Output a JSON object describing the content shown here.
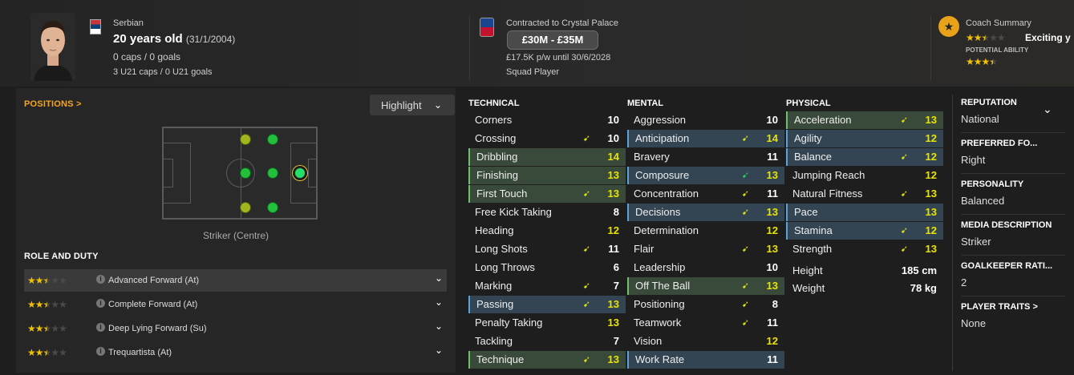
{
  "header": {
    "nationality": "Serbian",
    "age": "20 years old",
    "dob": "(31/1/2004)",
    "caps": "0 caps / 0 goals",
    "u21": "3 U21 caps / 0 U21 goals",
    "contract_title": "Contracted to Crystal Palace",
    "value": "£30M - £35M",
    "wage": "£17.5K p/w until 30/6/2028",
    "squad_status": "Squad Player",
    "coach_title": "Coach Summary",
    "coach_text": "Exciting y",
    "coach_current_stars": 2.5,
    "potential_label": "POTENTIAL ABILITY",
    "potential_stars": 3.5
  },
  "positions": {
    "title": "POSITIONS >",
    "dropdown": "Highlight",
    "position_label": "Striker (Centre)"
  },
  "roles": {
    "title": "ROLE AND DUTY",
    "items": [
      {
        "label": "Advanced Forward (At)",
        "stars": 2.5
      },
      {
        "label": "Complete Forward (At)",
        "stars": 2.5
      },
      {
        "label": "Deep Lying Forward (Su)",
        "stars": 2.5
      },
      {
        "label": "Trequartista (At)",
        "stars": 2.5
      }
    ]
  },
  "technical": {
    "title": "TECHNICAL",
    "rows": [
      {
        "name": "Corners",
        "value": "10",
        "hl": "",
        "arrow": ""
      },
      {
        "name": "Crossing",
        "value": "10",
        "hl": "",
        "arrow": "y"
      },
      {
        "name": "Dribbling",
        "value": "14",
        "hl": "green",
        "arrow": ""
      },
      {
        "name": "Finishing",
        "value": "13",
        "hl": "green",
        "arrow": ""
      },
      {
        "name": "First Touch",
        "value": "13",
        "hl": "green",
        "arrow": "y"
      },
      {
        "name": "Free Kick Taking",
        "value": "8",
        "hl": "",
        "arrow": ""
      },
      {
        "name": "Heading",
        "value": "12",
        "hl": "",
        "arrow": ""
      },
      {
        "name": "Long Shots",
        "value": "11",
        "hl": "",
        "arrow": "y"
      },
      {
        "name": "Long Throws",
        "value": "6",
        "hl": "",
        "arrow": ""
      },
      {
        "name": "Marking",
        "value": "7",
        "hl": "",
        "arrow": "y"
      },
      {
        "name": "Passing",
        "value": "13",
        "hl": "blue",
        "arrow": "y"
      },
      {
        "name": "Penalty Taking",
        "value": "13",
        "hl": "",
        "arrow": ""
      },
      {
        "name": "Tackling",
        "value": "7",
        "hl": "",
        "arrow": ""
      },
      {
        "name": "Technique",
        "value": "13",
        "hl": "green",
        "arrow": "y"
      }
    ]
  },
  "mental": {
    "title": "MENTAL",
    "rows": [
      {
        "name": "Aggression",
        "value": "10",
        "hl": "",
        "arrow": ""
      },
      {
        "name": "Anticipation",
        "value": "14",
        "hl": "blue",
        "arrow": "y"
      },
      {
        "name": "Bravery",
        "value": "11",
        "hl": "",
        "arrow": ""
      },
      {
        "name": "Composure",
        "value": "13",
        "hl": "blue",
        "arrow": "g"
      },
      {
        "name": "Concentration",
        "value": "11",
        "hl": "",
        "arrow": "y"
      },
      {
        "name": "Decisions",
        "value": "13",
        "hl": "blue",
        "arrow": "y"
      },
      {
        "name": "Determination",
        "value": "12",
        "hl": "",
        "arrow": ""
      },
      {
        "name": "Flair",
        "value": "13",
        "hl": "",
        "arrow": "y"
      },
      {
        "name": "Leadership",
        "value": "10",
        "hl": "",
        "arrow": ""
      },
      {
        "name": "Off The Ball",
        "value": "13",
        "hl": "green",
        "arrow": "y"
      },
      {
        "name": "Positioning",
        "value": "8",
        "hl": "",
        "arrow": "y"
      },
      {
        "name": "Teamwork",
        "value": "11",
        "hl": "",
        "arrow": "y"
      },
      {
        "name": "Vision",
        "value": "12",
        "hl": "",
        "arrow": ""
      },
      {
        "name": "Work Rate",
        "value": "11",
        "hl": "blue",
        "arrow": ""
      }
    ]
  },
  "physical": {
    "title": "PHYSICAL",
    "rows": [
      {
        "name": "Acceleration",
        "value": "13",
        "hl": "green",
        "arrow": "y"
      },
      {
        "name": "Agility",
        "value": "12",
        "hl": "blue",
        "arrow": ""
      },
      {
        "name": "Balance",
        "value": "12",
        "hl": "blue",
        "arrow": "y"
      },
      {
        "name": "Jumping Reach",
        "value": "12",
        "hl": "",
        "arrow": ""
      },
      {
        "name": "Natural Fitness",
        "value": "13",
        "hl": "",
        "arrow": "y"
      },
      {
        "name": "Pace",
        "value": "13",
        "hl": "blue",
        "arrow": ""
      },
      {
        "name": "Stamina",
        "value": "12",
        "hl": "blue",
        "arrow": "y"
      },
      {
        "name": "Strength",
        "value": "13",
        "hl": "",
        "arrow": "y"
      }
    ],
    "height_label": "Height",
    "height": "185 cm",
    "weight_label": "Weight",
    "weight": "78 kg"
  },
  "info": {
    "items": [
      {
        "label": "REPUTATION",
        "value": "National"
      },
      {
        "label": "PREFERRED FO...",
        "value": "Right"
      },
      {
        "label": "PERSONALITY",
        "value": "Balanced"
      },
      {
        "label": "MEDIA DESCRIPTION",
        "value": "Striker"
      },
      {
        "label": "GOALKEEPER RATI...",
        "value": "2"
      },
      {
        "label": "PLAYER TRAITS >",
        "value": "None"
      }
    ]
  }
}
